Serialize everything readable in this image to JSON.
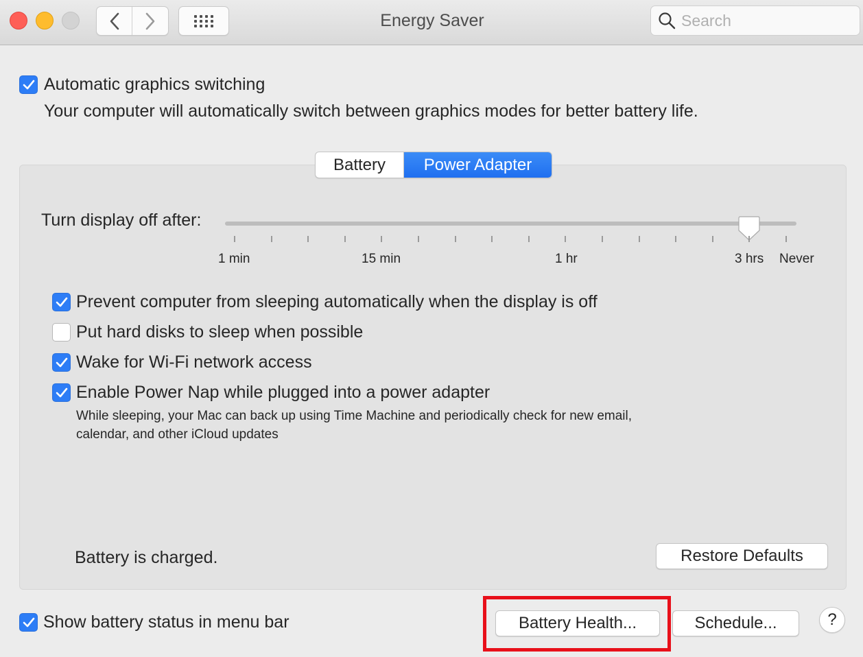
{
  "window": {
    "title": "Energy Saver",
    "search_placeholder": "Search"
  },
  "titlebar": {
    "traffic_lights": [
      "close",
      "minimize",
      "zoom"
    ],
    "icons": [
      "chevron-left-icon",
      "chevron-right-icon",
      "grid-icon",
      "search-icon"
    ]
  },
  "graphics": {
    "checkbox_label": "Automatic graphics switching",
    "checked": true,
    "description": "Your computer will automatically switch between graphics modes for better battery life."
  },
  "tabs": [
    {
      "label": "Battery",
      "selected": false
    },
    {
      "label": "Power Adapter",
      "selected": true
    }
  ],
  "display_slider": {
    "label": "Turn display off after:",
    "tick_labels": [
      "1 min",
      "15 min",
      "1 hr",
      "3 hrs",
      "Never"
    ],
    "value": "3 hrs",
    "tick_count": 16
  },
  "options": [
    {
      "label": "Prevent computer from sleeping automatically when the display is off",
      "checked": true
    },
    {
      "label": "Put hard disks to sleep when possible",
      "checked": false
    },
    {
      "label": "Wake for Wi-Fi network access",
      "checked": true
    },
    {
      "label": "Enable Power Nap while plugged into a power adapter",
      "checked": true
    }
  ],
  "power_nap_description": {
    "line1": "While sleeping, your Mac can back up using Time Machine and periodically check for new email,",
    "line2": "calendar, and other iCloud updates"
  },
  "status": "Battery is charged.",
  "buttons": {
    "restore_defaults": "Restore Defaults",
    "battery_health": "Battery Health...",
    "schedule": "Schedule...",
    "help": "?"
  },
  "menu_bar": {
    "label": "Show battery status in menu bar",
    "checked": true
  },
  "colors": {
    "accent": "#2d7df6",
    "highlight": "#e8101a"
  }
}
